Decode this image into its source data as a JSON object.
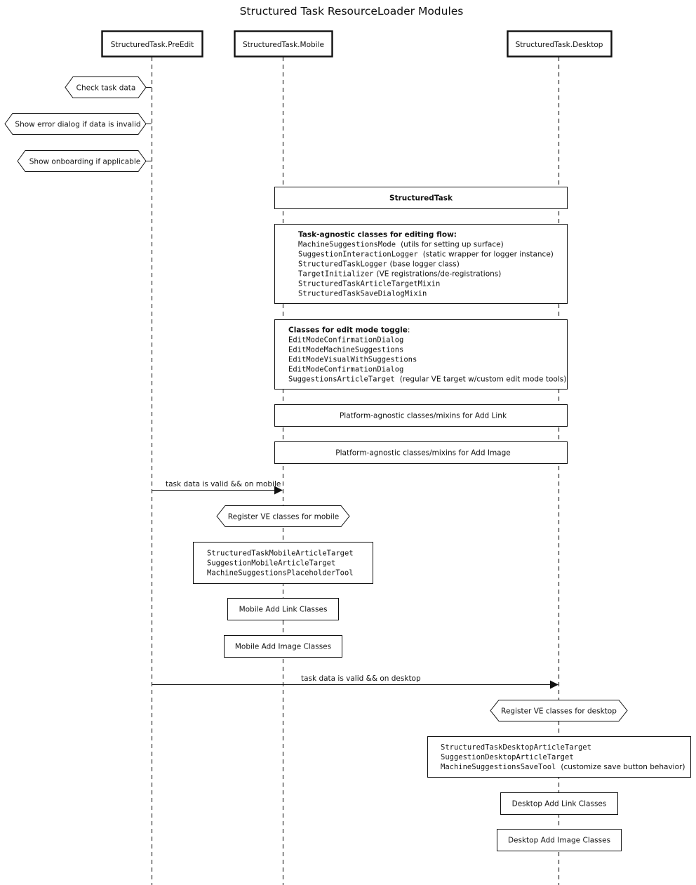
{
  "title": "Structured Task ResourceLoader Modules",
  "participants": [
    {
      "id": "preedit",
      "label": "StructuredTask.PreEdit"
    },
    {
      "id": "mobile",
      "label": "StructuredTask.Mobile"
    },
    {
      "id": "desktop",
      "label": "StructuredTask.Desktop"
    }
  ],
  "preedit_steps": [
    {
      "label": "Check task data"
    },
    {
      "label": "Show error dialog if data is invalid"
    },
    {
      "label": "Show onboarding if applicable"
    }
  ],
  "shared_boxes": {
    "structured_task": {
      "label": "StructuredTask"
    },
    "task_agnostic": {
      "heading": "Task-agnostic classes for editing flow:",
      "lines": [
        {
          "code": "MachineSuggestionsMode",
          "note": "(utils for setting up surface)"
        },
        {
          "code": "SuggestionInteractionLogger",
          "note": "(static wrapper for logger instance)"
        },
        {
          "code": "StructuredTaskLogger",
          "note": "(base logger class)"
        },
        {
          "code": "TargetInitializer",
          "note": "(VE registrations/de-registrations)"
        },
        {
          "code": "StructuredTaskArticleTargetMixin",
          "note": ""
        },
        {
          "code": "StructuredTaskSaveDialogMixin",
          "note": ""
        }
      ]
    },
    "edit_mode": {
      "heading": "Classes for edit mode toggle",
      "heading_suffix": ":",
      "lines": [
        {
          "code": "EditModeConfirmationDialog",
          "note": ""
        },
        {
          "code": "EditModeMachineSuggestions",
          "note": ""
        },
        {
          "code": "EditModeVisualWithSuggestions",
          "note": ""
        },
        {
          "code": "EditModeConfirmationDialog",
          "note": ""
        },
        {
          "code": "SuggestionsArticleTarget",
          "note": "(regular VE target w/custom edit mode tools)"
        }
      ]
    },
    "add_link": {
      "label": "Platform-agnostic classes/mixins for Add Link"
    },
    "add_image": {
      "label": "Platform-agnostic classes/mixins for Add Image"
    }
  },
  "messages": {
    "to_mobile": {
      "label": "task data is valid && on mobile"
    },
    "to_desktop": {
      "label": "task data is valid && on desktop"
    }
  },
  "mobile": {
    "register": "Register VE classes for mobile",
    "classes": [
      {
        "code": "StructuredTaskMobileArticleTarget",
        "note": ""
      },
      {
        "code": "SuggestionMobileArticleTarget",
        "note": ""
      },
      {
        "code": "MachineSuggestionsPlaceholderTool",
        "note": ""
      }
    ],
    "add_link": "Mobile Add Link Classes",
    "add_image": "Mobile Add Image Classes"
  },
  "desktop": {
    "register": "Register VE classes for desktop",
    "classes": [
      {
        "code": "StructuredTaskDesktopArticleTarget",
        "note": ""
      },
      {
        "code": "SuggestionDesktopArticleTarget",
        "note": ""
      },
      {
        "code": "MachineSuggestionsSaveTool",
        "note": "(customize save button behavior)"
      }
    ],
    "add_link": "Desktop Add Link Classes",
    "add_image": "Desktop Add Image Classes"
  }
}
